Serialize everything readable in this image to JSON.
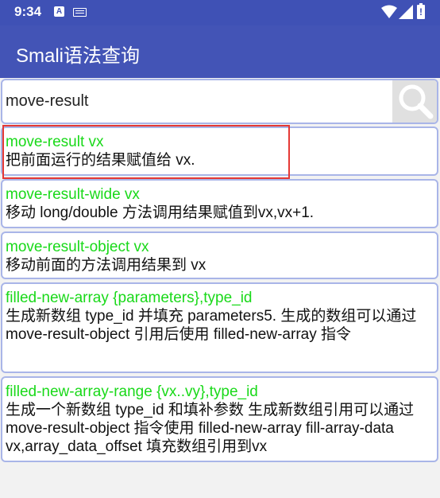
{
  "status_bar": {
    "time": "9:34",
    "notification_icon": "A",
    "battery_icon_text": "!"
  },
  "app_bar": {
    "title": "Smali语法查询"
  },
  "search": {
    "value": "move-result",
    "button_icon": "magnifier-icon"
  },
  "results": [
    {
      "title": "move-result vx",
      "desc": "把前面运行的结果赋值给 vx."
    },
    {
      "title": "move-result-wide vx",
      "desc": "移动 long/double 方法调用结果赋值到vx,vx+1."
    },
    {
      "title": "move-result-object vx",
      "desc": "移动前面的方法调用结果到 vx"
    },
    {
      "title": "filled-new-array {parameters},type_id",
      "desc": "生成新数组 type_id 并填充 parameters5. 生成的数组可以通过 move-result-object 引用后使用 filled-new-array 指令"
    },
    {
      "title": "filled-new-array-range {vx..vy},type_id",
      "desc": "生成一个新数组 type_id 和填补参数 生成新数组引用可以通过 move-result-object 指令使用 filled-new-array fill-array-data vx,array_data_offset 填充数组引用到vx"
    }
  ],
  "colors": {
    "primary": "#3f51b5",
    "title_green": "#19d919",
    "card_border": "#a9b5e8",
    "highlight_red": "#e53935"
  }
}
